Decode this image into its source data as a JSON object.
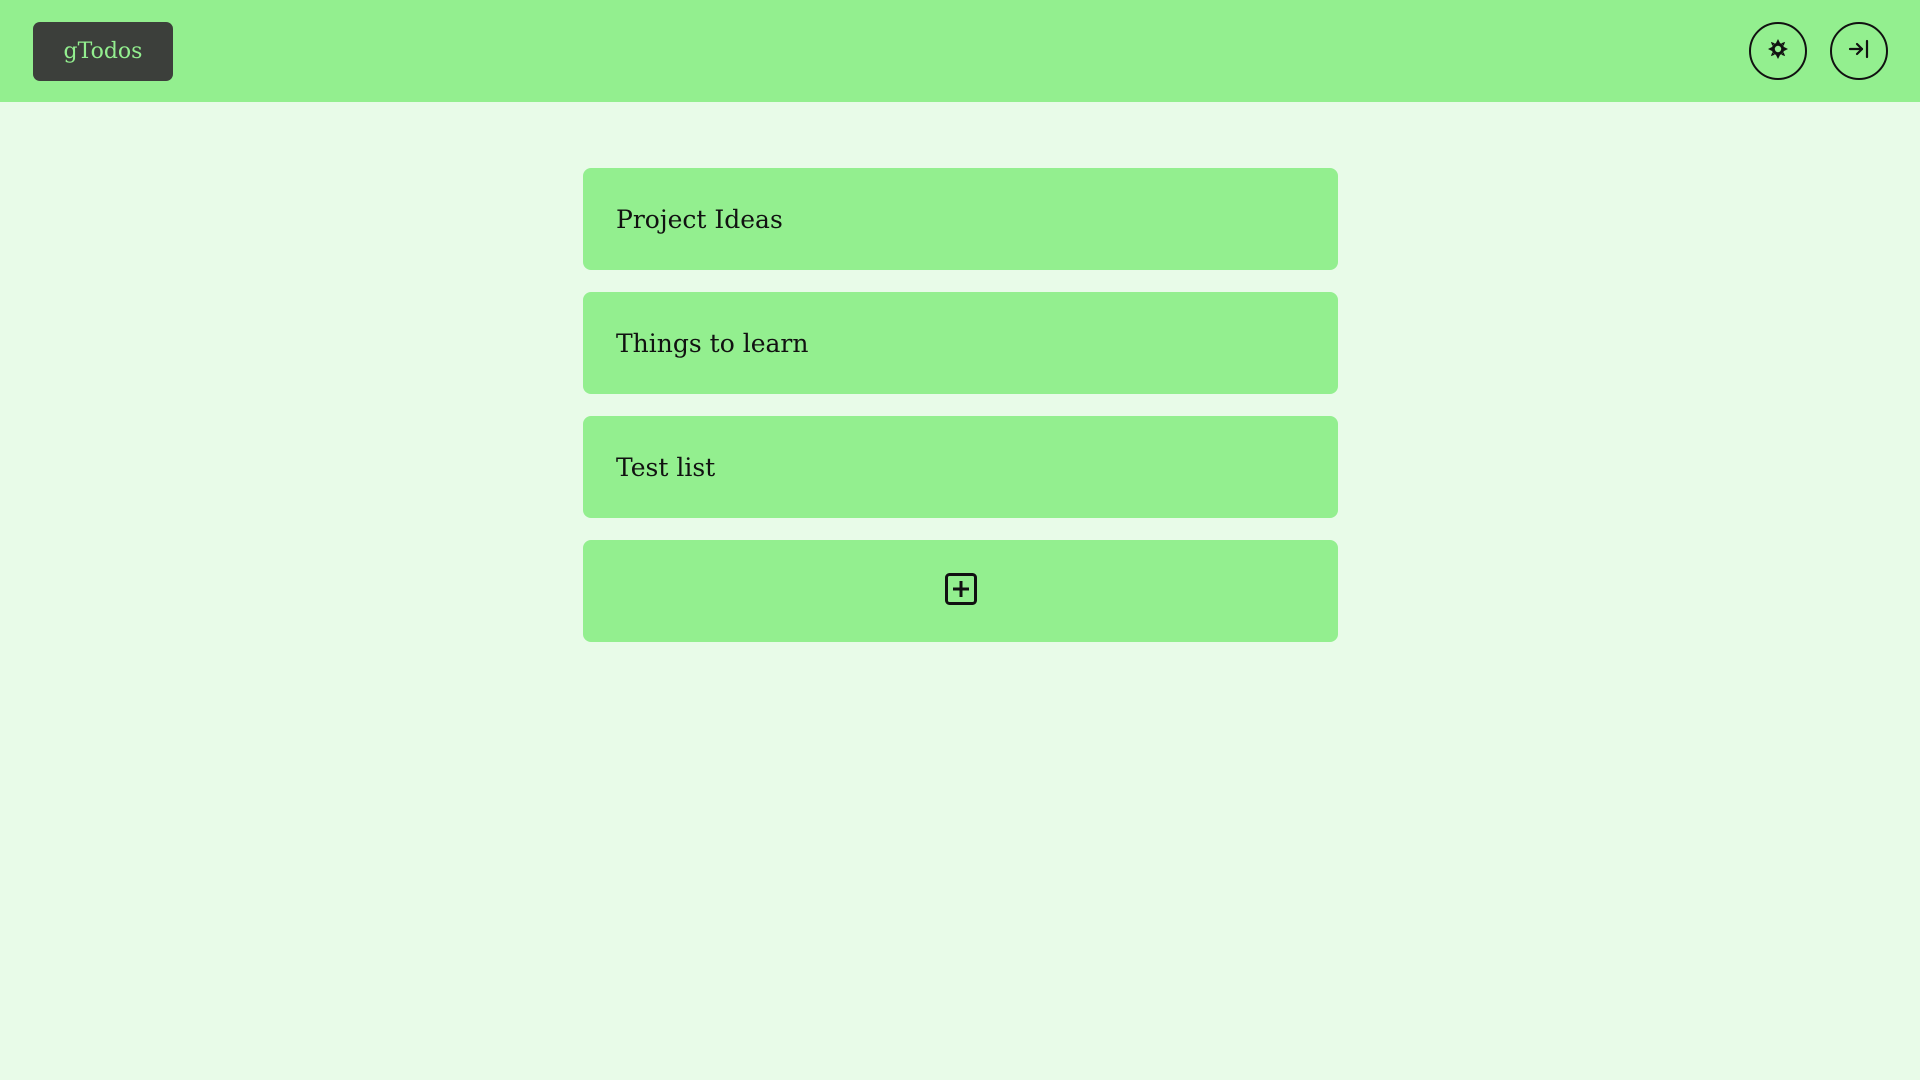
{
  "app": {
    "title": "gTodos"
  },
  "header": {
    "theme_icon": "sun-icon",
    "login_icon": "login-icon"
  },
  "lists": [
    {
      "label": "Project Ideas"
    },
    {
      "label": "Things to learn"
    },
    {
      "label": "Test list"
    }
  ],
  "add_list": {
    "icon": "plus-square-icon"
  },
  "colors": {
    "header_bg": "#93ef8f",
    "page_bg": "#e8fbe8",
    "card_bg": "#93ef8f",
    "logo_bg": "#3c3f3b",
    "logo_text": "#93ef8f"
  }
}
